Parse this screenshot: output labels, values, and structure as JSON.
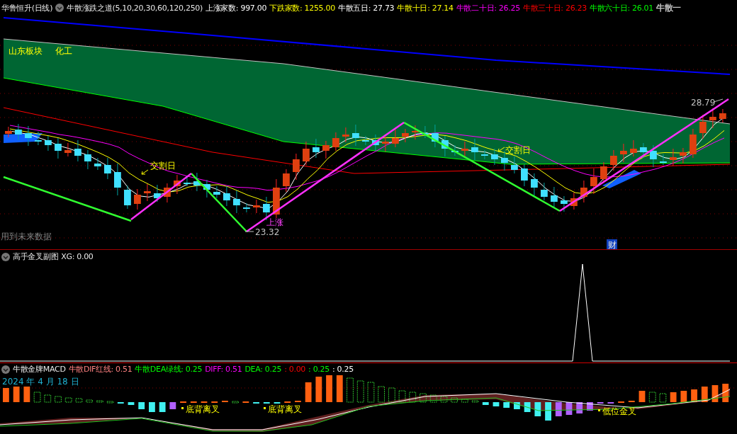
{
  "header": {
    "title": "华鲁恒升(日线)",
    "indicator": "牛散涨跌之道(5,10,20,30,60,120,250)",
    "values": [
      {
        "text": "上涨家数: 997.00",
        "color": "#ffffff"
      },
      {
        "text": "下跌家数: 1255.00",
        "color": "#ffff00"
      },
      {
        "text": "牛散五日: 27.73",
        "color": "#ffffff"
      },
      {
        "text": "牛散十日: 27.14",
        "color": "#ffff00"
      },
      {
        "text": "牛散二十日: 26.25",
        "color": "#ff00ff"
      },
      {
        "text": "牛散三十日: 26.23",
        "color": "#ff0000"
      },
      {
        "text": "牛散六十日: 26.01",
        "color": "#00ff00"
      },
      {
        "text": "牛散一",
        "color": "#c0c0c0"
      }
    ]
  },
  "main_chart": {
    "sector": "山东板块",
    "industry": "化工",
    "delivery_labels": [
      "交割日",
      "交割日"
    ],
    "rise_label": "上涨",
    "low_price": "23.32",
    "high_price": "28.79",
    "future_data_note": "用到未来数据",
    "finance_marker": "财"
  },
  "sub_chart": {
    "title": "高手金叉副图",
    "reading": "XG: 0.00"
  },
  "macd": {
    "title": "牛散金牌MACD",
    "values": [
      {
        "text": "牛散DIF红线: 0.51",
        "color": "#ff8080"
      },
      {
        "text": "牛散DEA绿线: 0.25",
        "color": "#00ff00"
      },
      {
        "text": "DIFF: 0.51",
        "color": "#ff00ff"
      },
      {
        "text": "DEA: 0.25",
        "color": "#00ff00"
      },
      {
        "text": ": 0.00",
        "color": "#ff0000"
      },
      {
        "text": ": 0.25",
        "color": "#00ff00"
      },
      {
        "text": ": 0.25",
        "color": "#ffffff"
      }
    ],
    "date": "2024 年 4 月 18 日",
    "signals": [
      "底背离叉",
      "底背离叉",
      "低位金叉"
    ]
  }
}
